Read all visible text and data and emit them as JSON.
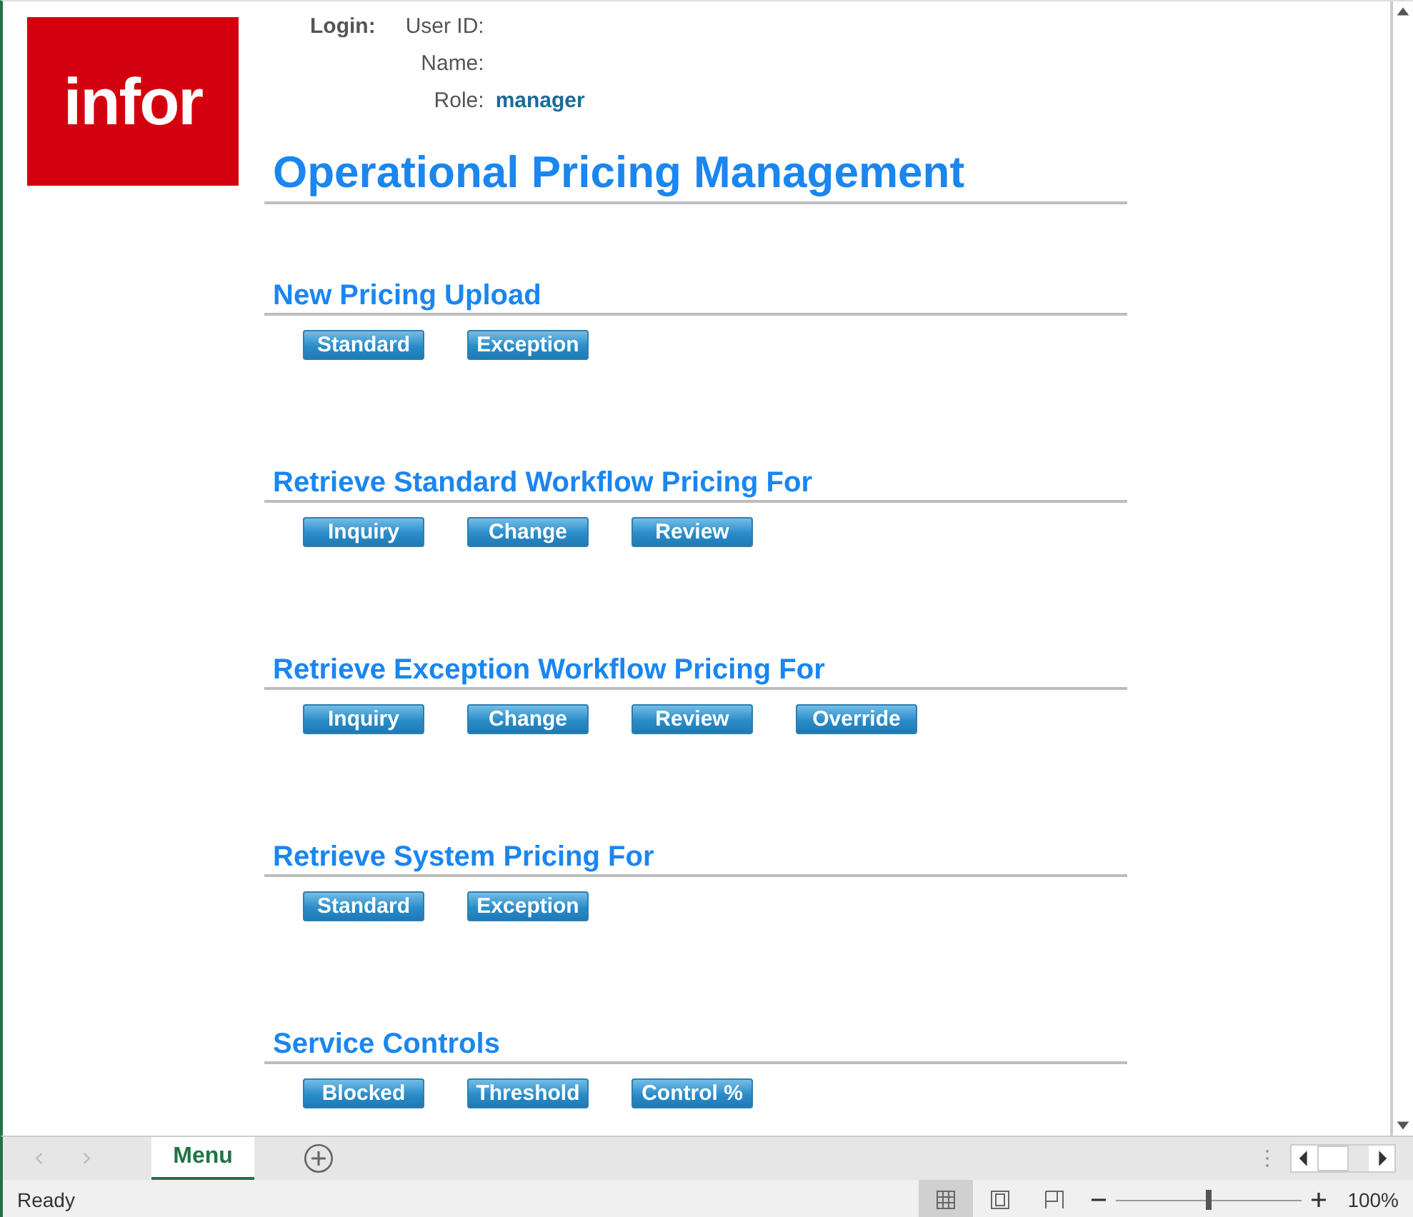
{
  "logo": {
    "text": "infor"
  },
  "login": {
    "label": "Login:",
    "fields": [
      {
        "label": "User ID:"
      },
      {
        "label": "Name:"
      },
      {
        "label": "Role:",
        "value": "manager"
      }
    ]
  },
  "title": "Operational Pricing Management",
  "sections": [
    {
      "heading": "New Pricing Upload",
      "buttons": [
        "Standard",
        "Exception"
      ]
    },
    {
      "heading": "Retrieve Standard Workflow Pricing For",
      "buttons": [
        "Inquiry",
        "Change",
        "Review"
      ]
    },
    {
      "heading": "Retrieve Exception Workflow Pricing For",
      "buttons": [
        "Inquiry",
        "Change",
        "Review",
        "Override"
      ]
    },
    {
      "heading": "Retrieve System Pricing For",
      "buttons": [
        "Standard",
        "Exception"
      ]
    },
    {
      "heading": "Service Controls",
      "buttons": [
        "Blocked",
        "Threshold",
        "Control %"
      ]
    }
  ],
  "sheet_tabs": [
    {
      "label": "Menu",
      "selected": true
    }
  ],
  "status_bar": {
    "status": "Ready",
    "views": [
      {
        "kind": "normal",
        "selected": true
      },
      {
        "kind": "layout",
        "selected": false
      },
      {
        "kind": "pagebreak",
        "selected": false
      }
    ],
    "zoom": {
      "level": 0.5,
      "reading": "100%"
    }
  }
}
